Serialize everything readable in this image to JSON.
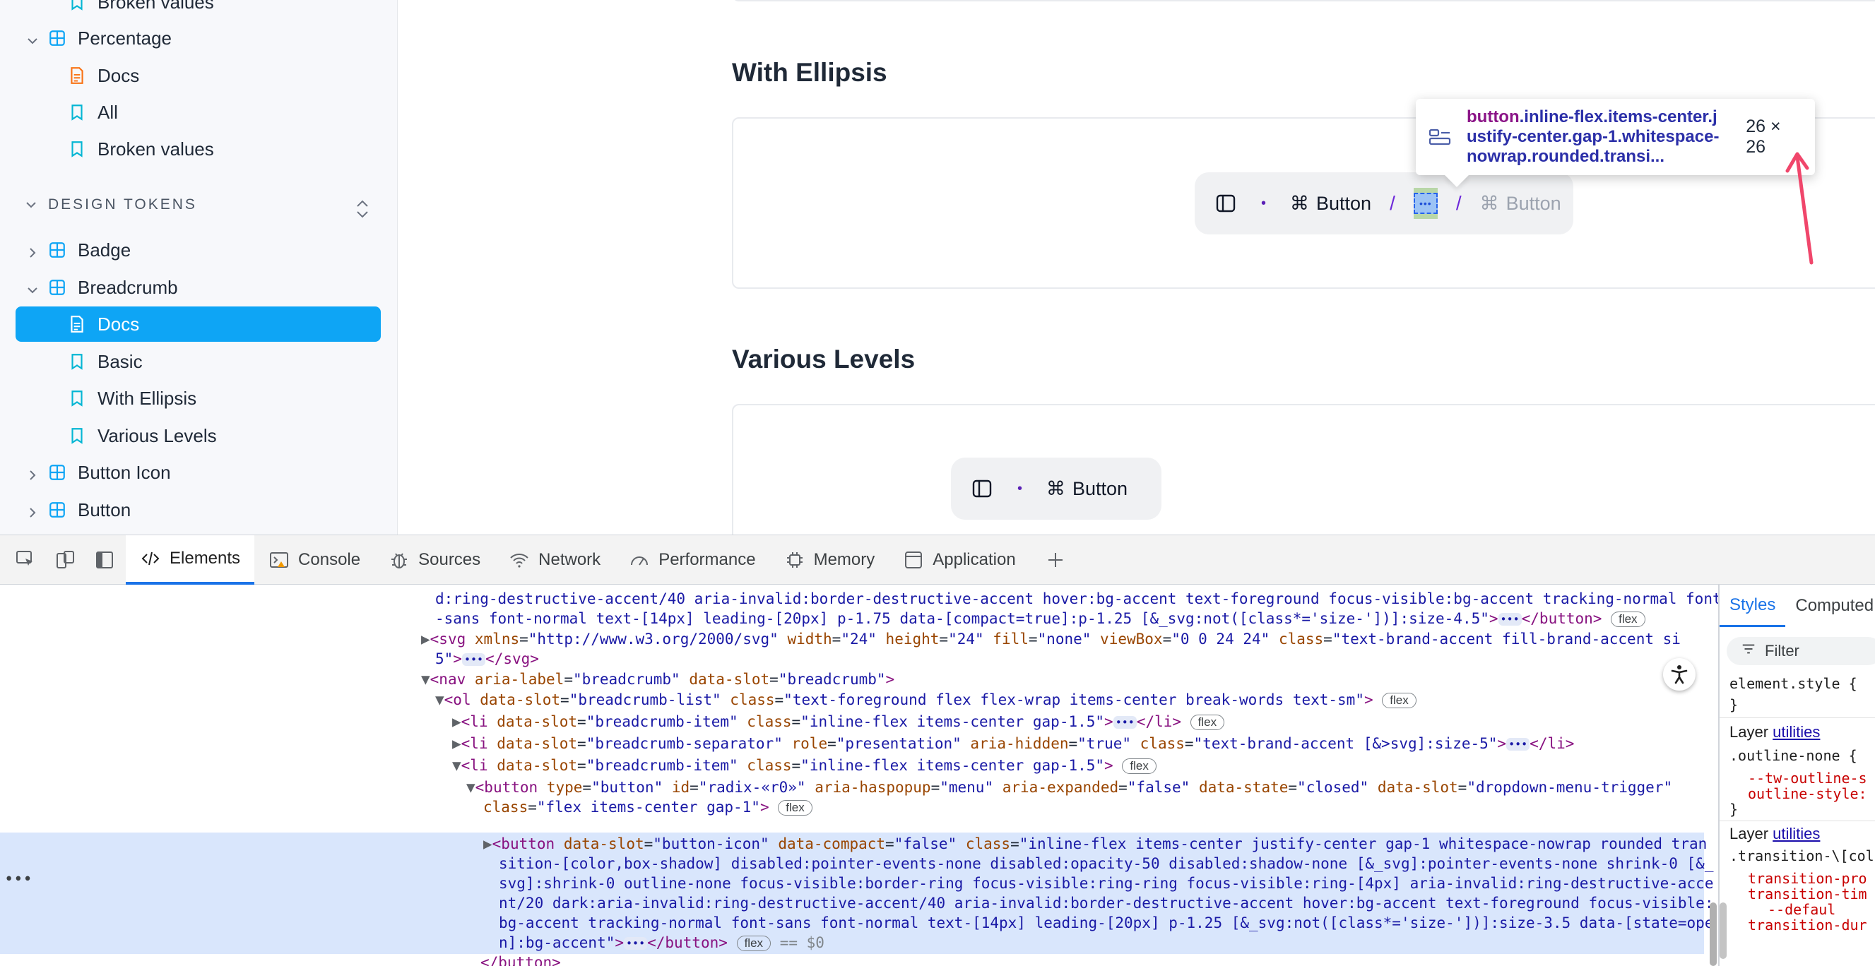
{
  "sidebar": {
    "items": [
      {
        "label": "Broken values",
        "kind": "story"
      },
      {
        "label": "Percentage",
        "kind": "component"
      },
      {
        "label": "Docs",
        "kind": "docs"
      },
      {
        "label": "All",
        "kind": "story"
      },
      {
        "label": "Broken values",
        "kind": "story"
      }
    ],
    "section_title": "DESIGN TOKENS",
    "tokens": [
      {
        "label": "Badge",
        "kind": "component"
      },
      {
        "label": "Breadcrumb",
        "kind": "component"
      },
      {
        "label": "Docs",
        "kind": "docs",
        "active": true
      },
      {
        "label": "Basic",
        "kind": "story"
      },
      {
        "label": "With Ellipsis",
        "kind": "story"
      },
      {
        "label": "Various Levels",
        "kind": "story"
      },
      {
        "label": "Button Icon",
        "kind": "component"
      },
      {
        "label": "Button",
        "kind": "component"
      }
    ]
  },
  "main": {
    "section1_title": "With Ellipsis",
    "section2_title": "Various Levels",
    "crumb1": {
      "button1": "Button",
      "button2": "Button",
      "sep": "/"
    },
    "crumb2": {
      "button1": "Button"
    },
    "tooltip": {
      "tag": "button",
      "classes": ".inline-flex.items-center.justify-center.gap-1.whitespace-nowrap.rounded.transi...",
      "size": "26 × 26"
    }
  },
  "devtools": {
    "tabs": [
      "Elements",
      "Console",
      "Sources",
      "Network",
      "Performance",
      "Memory",
      "Application"
    ],
    "active_tab": "Elements",
    "styles_tabs": [
      "Styles",
      "Computed"
    ],
    "filter_placeholder": "Filter",
    "styles_lines": {
      "element_style": "element.style {",
      "close": "}",
      "layer_label": "Layer",
      "layer_link": "utilities",
      "rule1": ".outline-none {",
      "rule1_prop1": "--tw-outline-s",
      "rule1_prop2": "outline-style:",
      "rule2": ".transition-\\[col",
      "rule2_prop1": "transition-pro",
      "rule2_prop2": "transition-tim",
      "rule2_prop3": "--defaul",
      "rule2_prop4": "transition-dur"
    }
  },
  "colors": {
    "accent": "#0ea5f5",
    "component_icon": "#0ea5f5",
    "docs_icon": "#f97316",
    "story_icon": "#06b6d4",
    "annotation_arrow": "#f0466b"
  }
}
